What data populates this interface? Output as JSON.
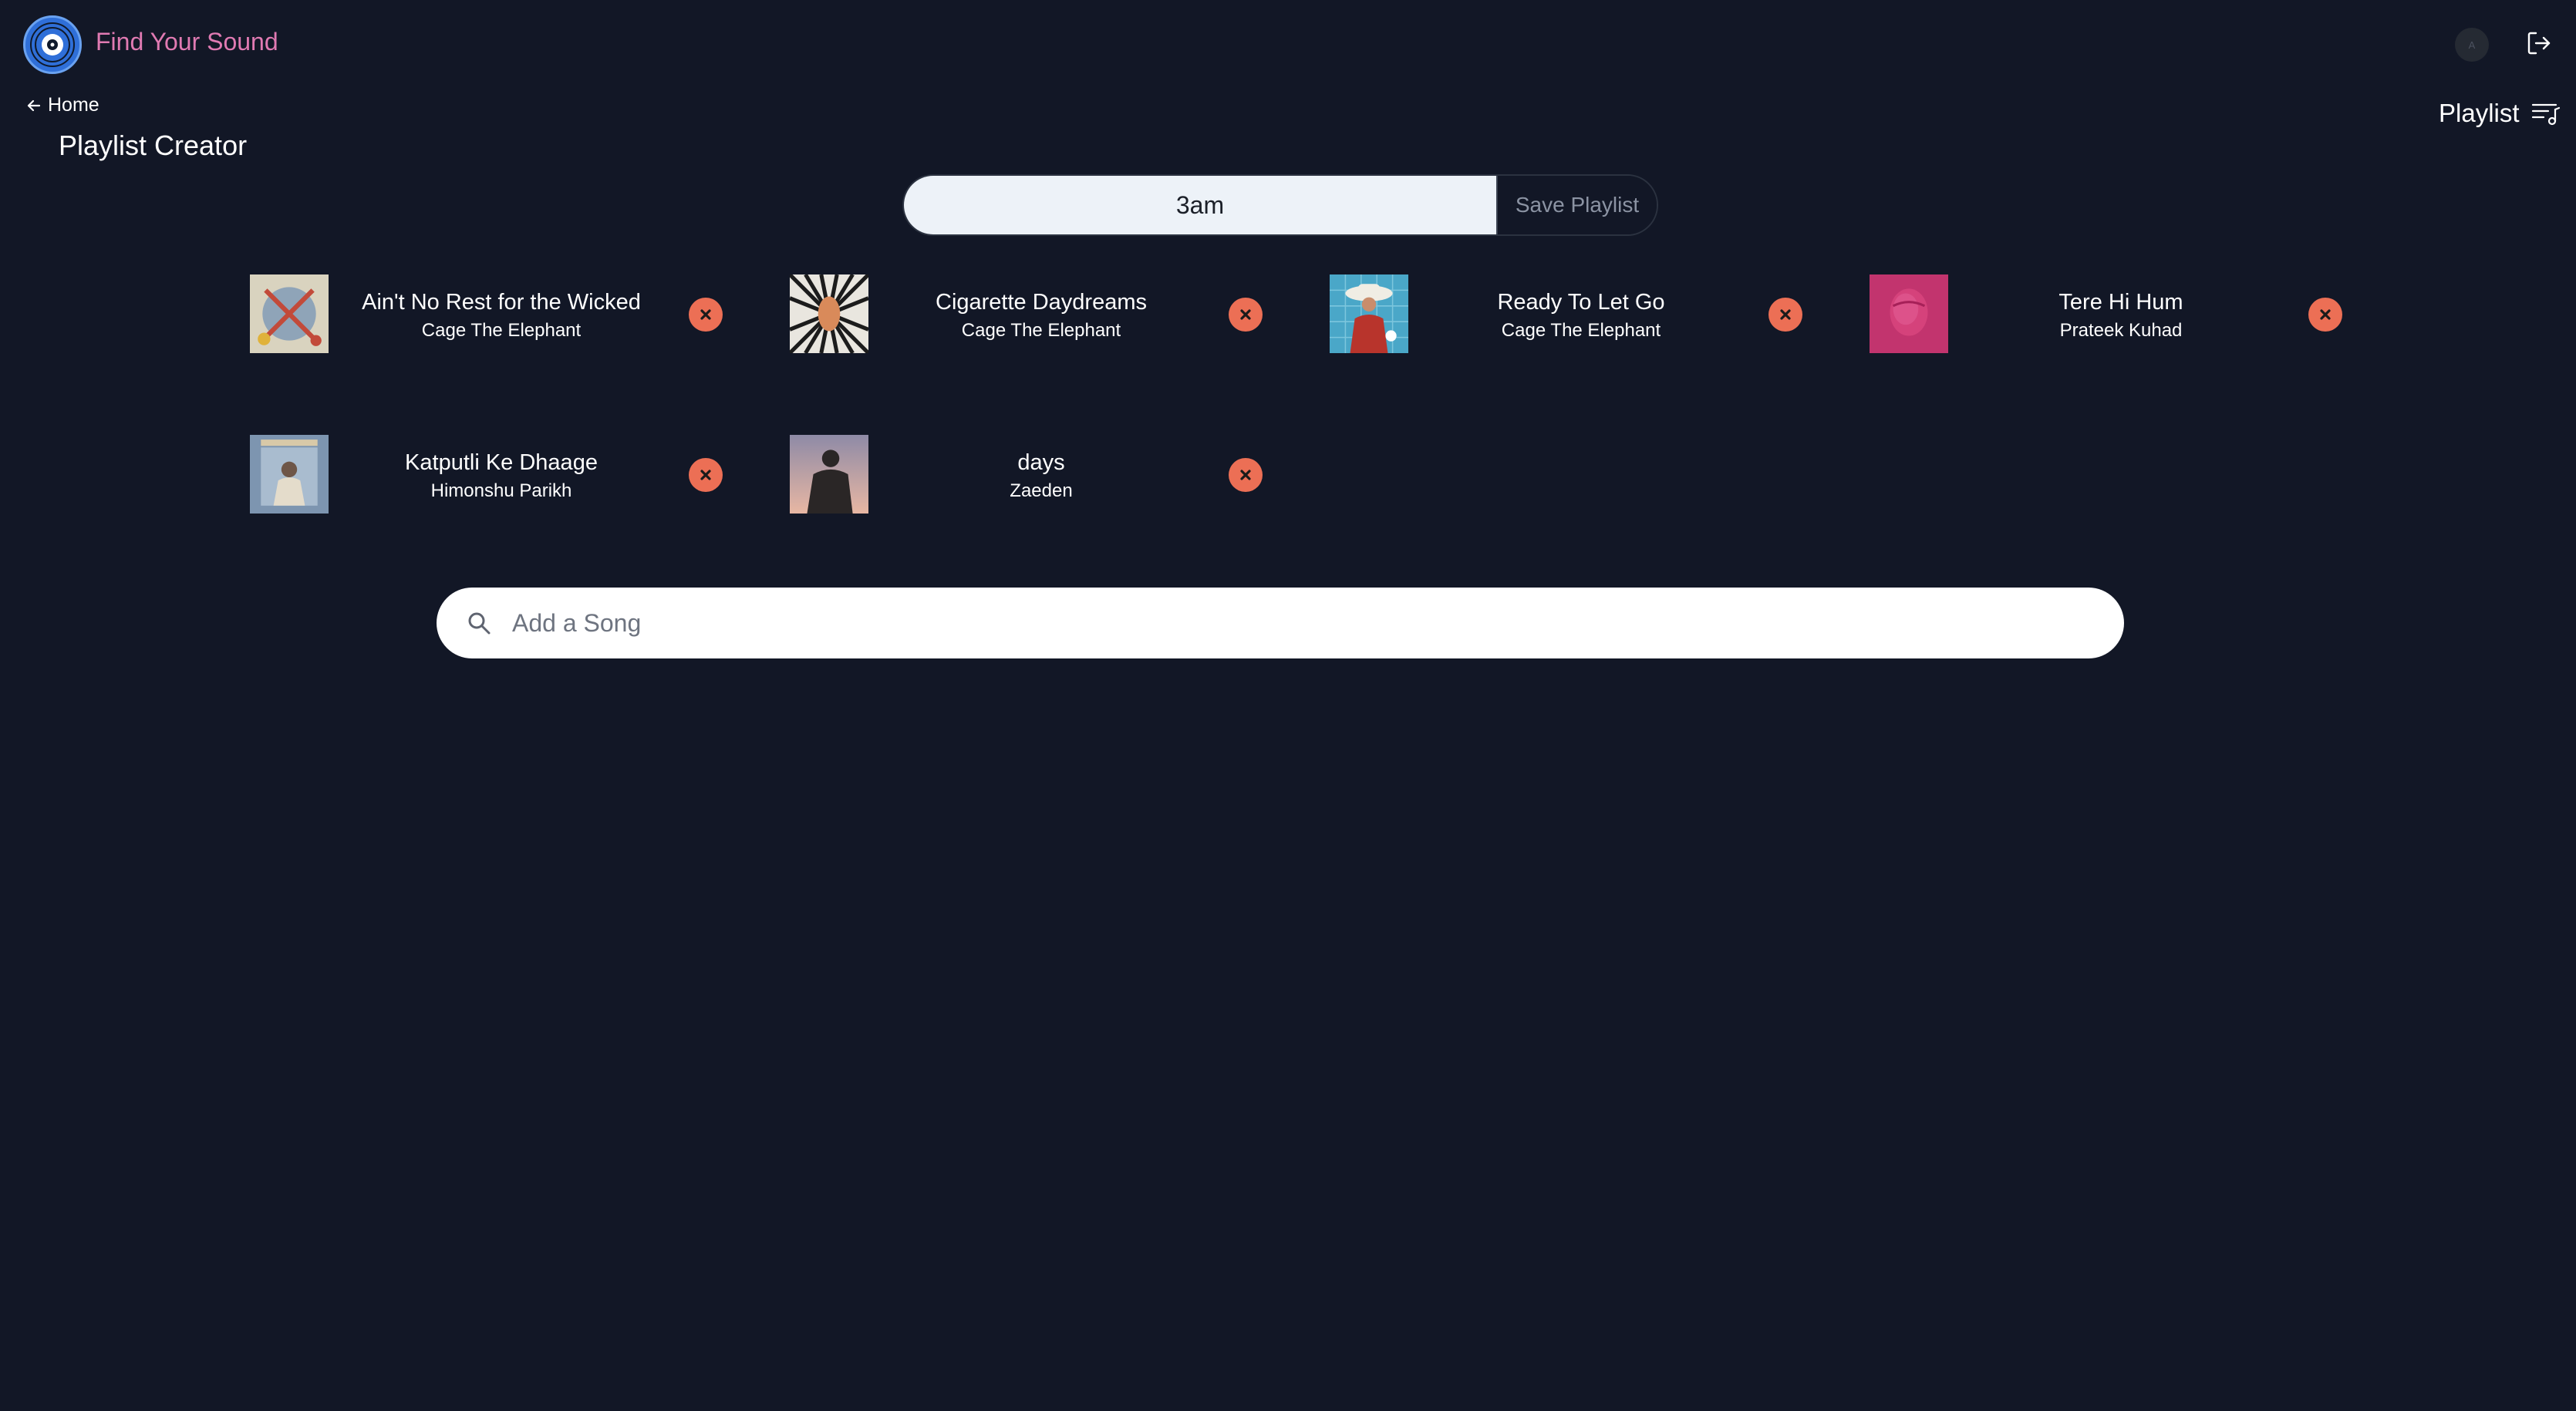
{
  "header": {
    "brand": "Find Your Sound",
    "avatar_initial": "A",
    "logout_icon": "logout-icon"
  },
  "nav": {
    "back_label": "Home"
  },
  "page": {
    "title": "Playlist Creator"
  },
  "playlist_toggle": {
    "label": "Playlist"
  },
  "playlist": {
    "name": "3am",
    "save_label": "Save Playlist"
  },
  "songs": [
    {
      "title": "Ain't No Rest for the Wicked",
      "artist": "Cage The Elephant",
      "cover_color": "#c9c7b8",
      "accent": "#c24a3a"
    },
    {
      "title": "Cigarette Daydreams",
      "artist": "Cage The Elephant",
      "cover_color": "#e8e6e0",
      "accent": "#d98a5a"
    },
    {
      "title": "Ready To Let Go",
      "artist": "Cage The Elephant",
      "cover_color": "#4aa7c8",
      "accent": "#b8342c"
    },
    {
      "title": "Tere Hi Hum",
      "artist": "Prateek Kuhad",
      "cover_color": "#c2346e",
      "accent": "#e05a92"
    },
    {
      "title": "Katputli Ke Dhaage",
      "artist": "Himonshu Parikh",
      "cover_color": "#7d95b0",
      "accent": "#d8c9a8"
    },
    {
      "title": "days",
      "artist": "Zaeden",
      "cover_color": "#c9a79a",
      "accent": "#2a2626"
    }
  ],
  "search": {
    "placeholder": "Add a Song"
  },
  "colors": {
    "background": "#121726",
    "brand": "#e07ab2",
    "remove": "#ec6f55",
    "logo": "#2f6fd8"
  }
}
